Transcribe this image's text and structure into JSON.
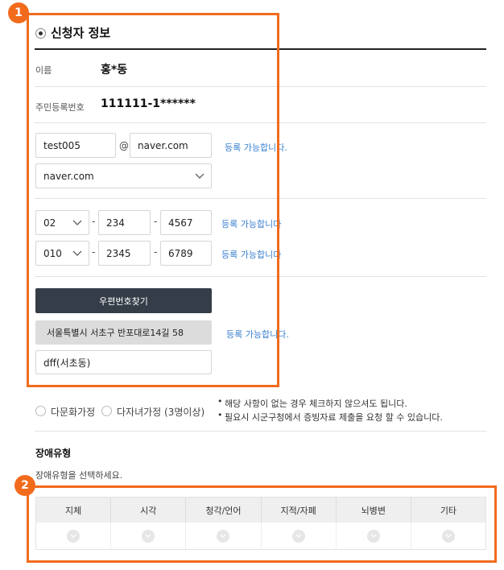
{
  "section": {
    "title": "신청자 정보"
  },
  "name": {
    "label": "이름",
    "value": "홍*동"
  },
  "rrn": {
    "label": "주민등록번호",
    "value": "111111-1******"
  },
  "email": {
    "local": "test005",
    "at": "@",
    "domain": "naver.com",
    "domain_select": "naver.com",
    "status": "등록 가능합니다."
  },
  "phone": {
    "area": "02",
    "mid": "234",
    "last": "4567",
    "sep": "-",
    "status": "등록 가능합니다"
  },
  "mobile": {
    "prefix": "010",
    "mid": "2345",
    "last": "6789",
    "sep": "-",
    "status": "등록 가능합니다"
  },
  "address": {
    "search_button": "우편번호찾기",
    "road": "서울특별시 서초구 반포대로14길 58",
    "detail": "dff(서초동)",
    "status": "등록 가능합니다."
  },
  "family": {
    "opt1": "다문화가정",
    "opt2": "다자녀가정 (3명이상)",
    "note1": "해당 사항이 없는 경우 체크하지 않으셔도 됩니다.",
    "note2": "필요시 시군구청에서 증빙자료 제출을 요청 할 수 있습니다."
  },
  "disability": {
    "title": "장애유형",
    "hint": "장애유형을 선택하세요.",
    "types": [
      "지체",
      "시각",
      "청각/언어",
      "지적/자폐",
      "뇌병변",
      "기타"
    ]
  },
  "badges": {
    "one": "1",
    "two": "2"
  },
  "colors": {
    "accent": "#f26b1d",
    "link": "#3a7fd0",
    "dark_button": "#353d48"
  }
}
